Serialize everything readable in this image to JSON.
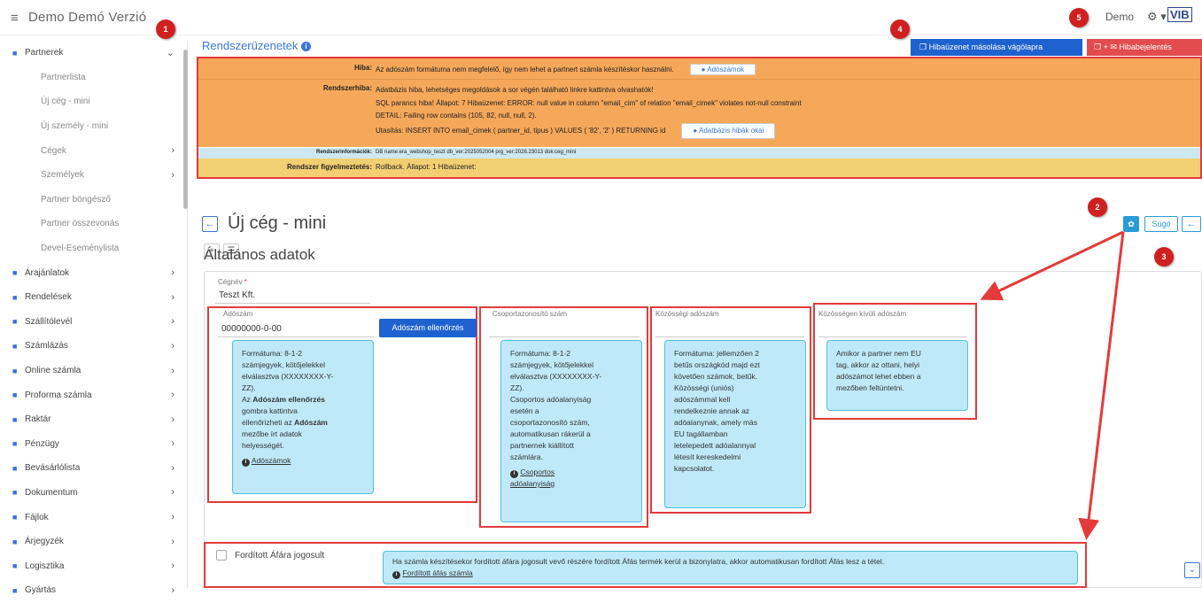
{
  "topbar": {
    "app_title": "Demo Demó Verzió",
    "user": "Demo",
    "gear": "⚙ ▾",
    "logo": "VIB"
  },
  "sidebar": {
    "items": [
      {
        "label": "Partnerek",
        "icon": "partner-icon",
        "sub": false,
        "chev": "⌄"
      },
      {
        "label": "Partnerlista",
        "sub": true
      },
      {
        "label": "Új cég - mini",
        "sub": true
      },
      {
        "label": "Új személy - mini",
        "sub": true
      },
      {
        "label": "Cégek",
        "sub": true,
        "chev": "›"
      },
      {
        "label": "Személyek",
        "sub": true,
        "chev": "›"
      },
      {
        "label": "Partner böngésző",
        "sub": true
      },
      {
        "label": "Partner összevonás",
        "sub": true
      },
      {
        "label": "Devel-Eseménylista",
        "sub": true
      },
      {
        "label": "Árajánlatok",
        "icon": "offer-icon",
        "chev": "›"
      },
      {
        "label": "Rendelések",
        "icon": "order-icon",
        "chev": "›"
      },
      {
        "label": "Szállítólevél",
        "icon": "delivery-icon",
        "chev": "›"
      },
      {
        "label": "Számlázás",
        "icon": "invoice-icon",
        "chev": "›"
      },
      {
        "label": "Online számla",
        "icon": "online-invoice-icon",
        "chev": "›"
      },
      {
        "label": "Proforma számla",
        "icon": "proforma-icon",
        "chev": "›"
      },
      {
        "label": "Raktár",
        "icon": "warehouse-icon",
        "chev": "›"
      },
      {
        "label": "Pénzügy",
        "icon": "finance-icon",
        "chev": "›"
      },
      {
        "label": "Bevásárlólista",
        "icon": "shopping-icon",
        "chev": "›"
      },
      {
        "label": "Dokumentum",
        "icon": "document-icon",
        "chev": "›"
      },
      {
        "label": "Fájlok",
        "icon": "file-icon",
        "chev": "›"
      },
      {
        "label": "Árjegyzék",
        "icon": "pricelist-icon",
        "chev": "›"
      },
      {
        "label": "Logisztika",
        "icon": "logistics-icon",
        "chev": "›"
      },
      {
        "label": "Gyártás",
        "icon": "production-icon",
        "chev": "›"
      }
    ]
  },
  "header": {
    "title": "Rendszerüzenetek",
    "copy_btn": "Hibaüzenet másolása vágólapra",
    "bug_btn": "+ ✉ Hibabejelentés"
  },
  "system": {
    "error_label": "Hiba:",
    "error_text": "Az adószám formátuma nem megfelelő, így nem lehet a partnert számla készítéskor használni.",
    "error_chip": "Adószámok",
    "syserr_label": "Rendszerhiba:",
    "syserr_lines": [
      "Adatbázis hiba, lehetséges megoldások a sor végén található linkre kattintva olvashatók!",
      "SQL parancs hiba! Állapot: 7 Hibaüzenet: ERROR:  null value in column \"email_cim\" of relation \"email_cimek\" violates not-null constraint",
      "DETAIL:  Failing row contains (105, 82, null, null, 2).",
      "Utasítás: INSERT INTO email_cimek ( partner_id, tipus ) VALUES ( '82', '2' ) RETURNING id"
    ],
    "syserr_chip": "Adatbázis hibák okai",
    "info_label": "Rendszerinformációk:",
    "info_text": "DB name:era_webshop_teszt db_ver:2025052004 prg_ver:2026.23013 dok:ceg_mini",
    "warn_label": "Rendszer figyelmeztetés:",
    "warn_text": "Rollback. Állapot: 1 Hibaüzenet:"
  },
  "page": {
    "title": "Új cég - mini",
    "help": "Súgó",
    "section": "Általános adatok"
  },
  "form": {
    "company_label": "Cégnév",
    "company_value": "Teszt Kft.",
    "tax_label": "Adószám",
    "tax_value": "00000000-0-00",
    "tax_check": "Adószám ellenőrzés",
    "group_label": "Csoportazonosító szám",
    "eu_label": "Közösségi adószám",
    "noneu_label": "Közösségen kívüli adószám",
    "reverse_label": "Fordított Áfára jogosult"
  },
  "tips": {
    "tax": [
      "Formátuma: 8-1-2",
      "számjegyek, kötőjelekkel",
      "elválasztva (XXXXXXXX-Y-",
      "ZZ).",
      "Az ",
      "Adószám ellenőrzés",
      "gombra kattintva",
      "ellenőrizheti az ",
      "Adószám",
      "mezőbe írt adatok",
      "helyességét.",
      "Adószámok"
    ],
    "group": [
      "Formátuma: 8-1-2",
      "számjegyek, kötőjelekkel",
      "elválasztva (XXXXXXXX-Y-",
      "ZZ).",
      "Csoportos adóalanyiság",
      "esetén a",
      "csoportazonosító szám,",
      "automatikusan rákerül a",
      "partnernek kiállított",
      "számlára.",
      "Csoportos",
      "adóalanyiság"
    ],
    "eu": [
      "Formátuma: jellemzően 2",
      "betűs országkód majd ezt",
      "követően számok, betűk.",
      "Közösségi (uniós)",
      "adószámmal kell",
      "rendelkeznie annak az",
      "adóalanynak, amely más",
      "EU tagállamban",
      "letelepedett adóalannyal",
      "létesít kereskedelmi",
      "kapcsolatot."
    ],
    "noneu": [
      "Amikor a partner nem EU",
      "tag, akkor az ottani, helyi",
      "adószámot lehet ebben a",
      "mezőben feltüntetni."
    ],
    "reverse": [
      "Ha számla készítésekor fordított áfára jogosult vevő részére fordított Áfás termék kerül a bizonylatra, akkor automatikusan fordított Áfás lesz a tétel.",
      "Fordított áfás számla"
    ]
  },
  "markers": [
    "1",
    "2",
    "3",
    "4",
    "5"
  ]
}
